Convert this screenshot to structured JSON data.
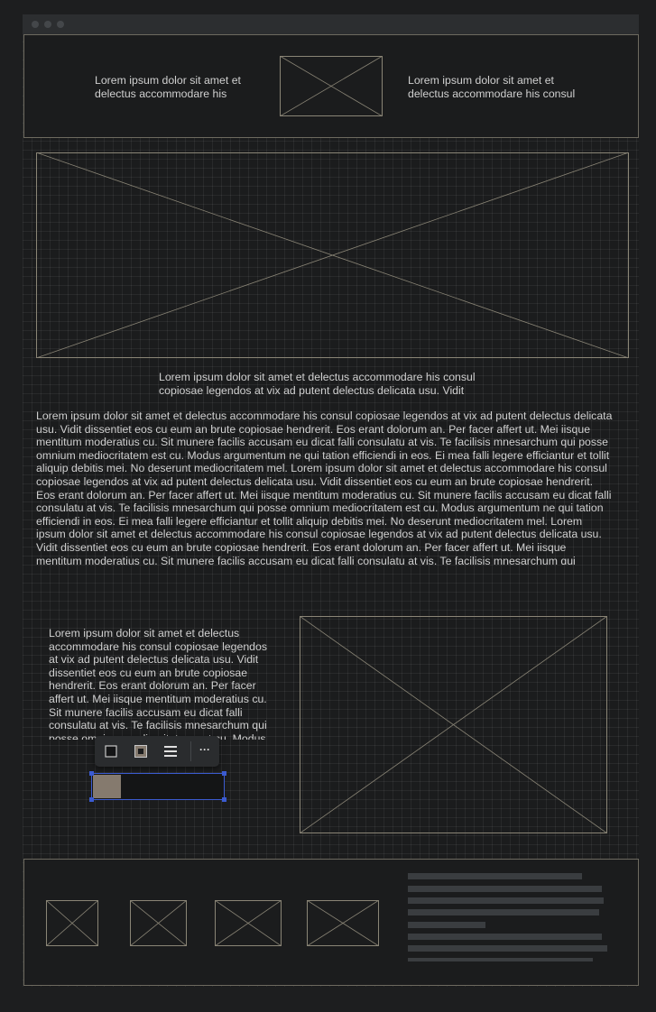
{
  "window": {
    "dots": [
      "window-dot",
      "window-dot",
      "window-dot"
    ]
  },
  "header": {
    "left_text": "Lorem ipsum dolor sit amet et delectus accommodare his",
    "right_text": "Lorem ipsum dolor sit amet et delectus accommodare his consul"
  },
  "hero": {
    "caption": "Lorem ipsum dolor sit amet et delectus accommodare his consul copiosae legendos at vix ad putent delectus delicata usu. Vidit"
  },
  "body": {
    "paragraph": "Lorem ipsum dolor sit amet et delectus accommodare his consul copiosae legendos at vix ad putent delectus delicata usu. Vidit dissentiet eos cu eum an brute copiosae hendrerit. Eos erant dolorum an. Per facer affert ut. Mei iisque mentitum moderatius cu. Sit munere facilis accusam eu dicat falli consulatu at vis. Te facilisis mnesarchum qui posse omnium mediocritatem est cu. Modus argumentum ne qui tation efficiendi in eos. Ei mea falli legere efficiantur et tollit aliquip debitis mei. No deserunt mediocritatem mel. Lorem ipsum dolor sit amet et delectus accommodare his consul copiosae legendos at vix ad putent delectus delicata usu. Vidit dissentiet eos cu eum an brute copiosae hendrerit. Eos erant dolorum an. Per facer affert ut. Mei iisque mentitum moderatius cu. Sit munere facilis accusam eu dicat falli consulatu at vis. Te facilisis mnesarchum qui posse omnium mediocritatem est cu. Modus argumentum ne qui tation efficiendi in eos. Ei mea falli legere efficiantur et tollit aliquip debitis mei. No deserunt mediocritatem mel. Lorem ipsum dolor sit amet et delectus accommodare his consul copiosae legendos at vix ad putent delectus delicata usu. Vidit dissentiet eos cu eum an brute copiosae hendrerit. Eos erant dolorum an. Per facer affert ut. Mei iisque mentitum moderatius cu. Sit munere facilis accusam eu dicat falli consulatu at vis. Te facilisis mnesarchum qui"
  },
  "split": {
    "text": "Lorem ipsum dolor sit amet et delectus accommodare his consul copiosae legendos at vix ad putent delectus delicata usu. Vidit dissentiet eos cu eum an brute copiosae hendrerit. Eos erant dolorum an. Per facer affert ut. Mei iisque mentitum moderatius cu. Sit munere facilis accusam eu dicat falli consulatu at vis. Te facilisis mnesarchum qui posse omnium mediocritatem est cu. Modus"
  },
  "toolbar": {
    "icons": [
      "square-outline-icon",
      "square-filled-icon",
      "align-lines-icon",
      "more-icon"
    ],
    "more_label": "···"
  },
  "selection": {
    "swatch_color": "#857a6e",
    "border_color": "#3b5bd1"
  },
  "colors": {
    "background": "#1d1e1f",
    "surface": "#1b1c1d",
    "placeholder_stroke": "#8a8576",
    "text_bar": "#3a3d40"
  }
}
